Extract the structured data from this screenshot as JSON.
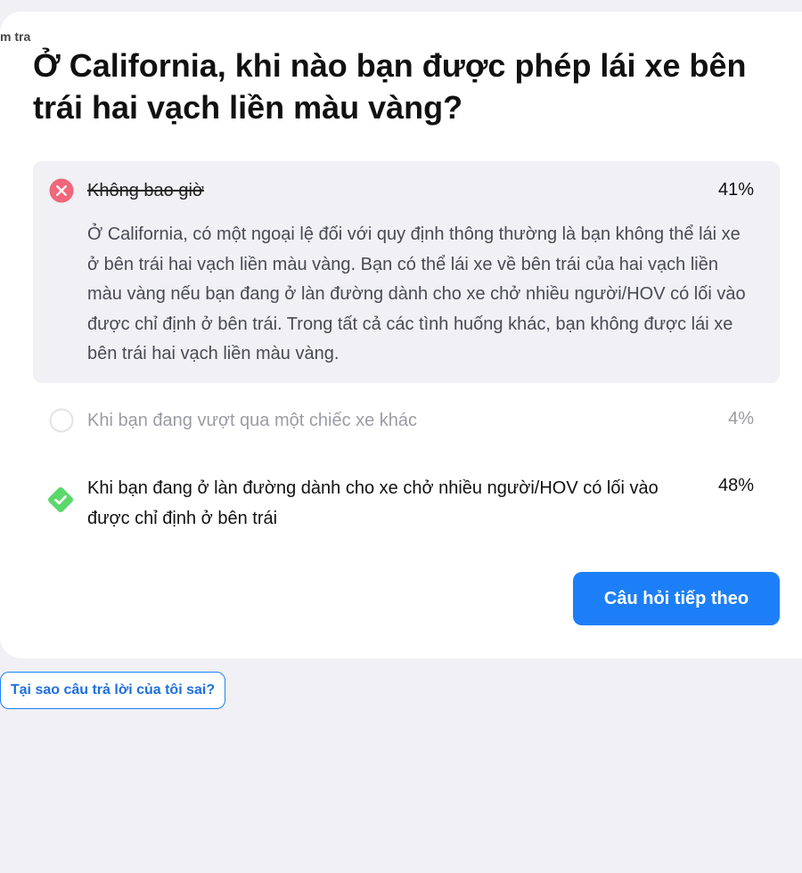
{
  "breadcrumb": "m tra",
  "question": "Ở California, khi nào bạn được phép lái xe bên trái hai vạch liền màu vàng?",
  "answers": [
    {
      "text": "Không bao giờ",
      "percent": "41%",
      "status": "incorrect-selected",
      "icon": "x-circle-icon",
      "explanation": "Ở California, có một ngoại lệ đối với quy định thông thường là bạn không thể lái xe ở bên trái hai vạch liền màu vàng. Bạn có thể lái xe về bên trái của hai vạch liền màu vàng nếu bạn đang ở làn đường dành cho xe chở nhiều người/HOV có lối vào được chỉ định ở bên trái. Trong tất cả các tình huống khác, bạn không được lái xe bên trái hai vạch liền màu vàng."
    },
    {
      "text": "Khi bạn đang vượt qua một chiếc xe khác",
      "percent": "4%",
      "status": "unselected",
      "icon": "empty-circle-icon"
    },
    {
      "text": "Khi bạn đang ở làn đường dành cho xe chở nhiều người/HOV có lối vào được chỉ định ở bên trái",
      "percent": "48%",
      "status": "correct",
      "icon": "check-diamond-icon"
    }
  ],
  "buttons": {
    "next": "Câu hỏi tiếp theo",
    "why_wrong": "Tại sao câu trả lời của tôi sai?"
  },
  "colors": {
    "accent": "#1d7ff7",
    "incorrect": "#f0667a",
    "correct": "#5ad86a",
    "background": "#f0f0f5"
  }
}
